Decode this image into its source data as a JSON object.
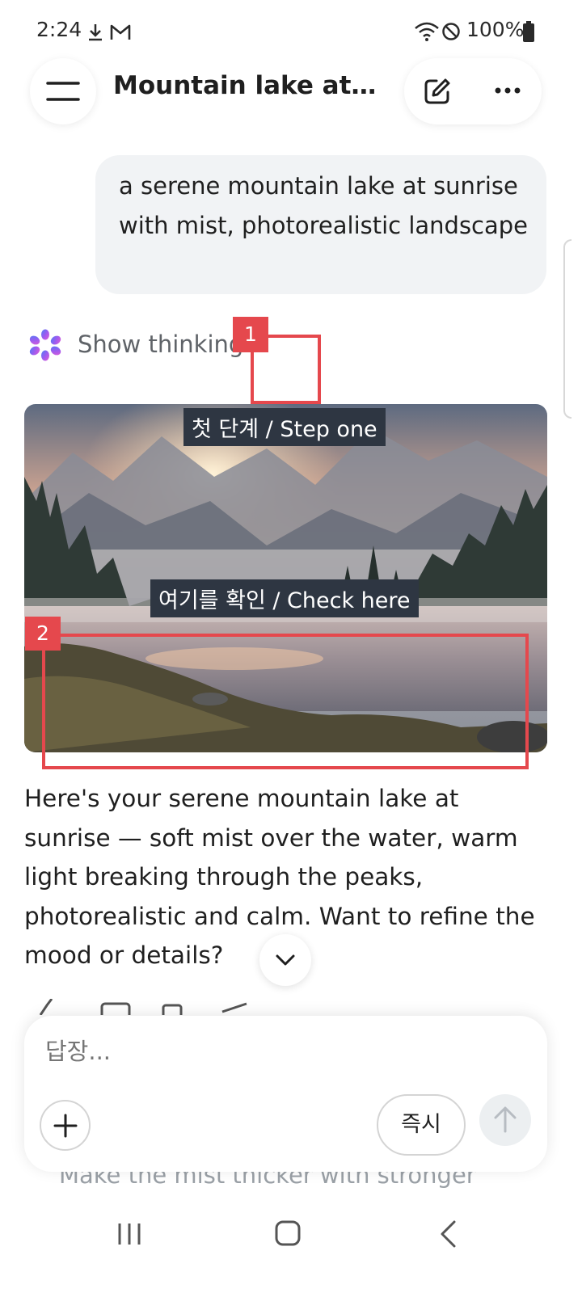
{
  "status_bar": {
    "time": "2:24",
    "battery_percent": "100%",
    "icons": [
      "download-icon",
      "gmail-icon",
      "wifi-icon",
      "do-not-disturb-icon",
      "battery-icon"
    ]
  },
  "header": {
    "title": "Mountain lake at s..."
  },
  "user_message": {
    "text": "a serene mountain lake at sunrise with mist, photorealistic landscape"
  },
  "thinking": {
    "label": "Show thinking"
  },
  "annotations": [
    {
      "number": "1",
      "caption": "첫 단계 / Step one"
    },
    {
      "number": "2",
      "caption": "여기를 확인 / Check here"
    }
  ],
  "response": {
    "text": "Here's your serene mountain lake at sunrise — soft mist over the water, warm light breaking through the peaks, photorealistic and calm. Want to refine the mood or details?"
  },
  "composer": {
    "placeholder": "답장...",
    "mode_button": "즉시"
  },
  "suggestion": {
    "text": "Make the mist thicker with stronger"
  },
  "colors": {
    "annotation_red": "#e5484d",
    "caption_bg": "#2e3642",
    "bubble_bg": "#f1f3f5"
  }
}
